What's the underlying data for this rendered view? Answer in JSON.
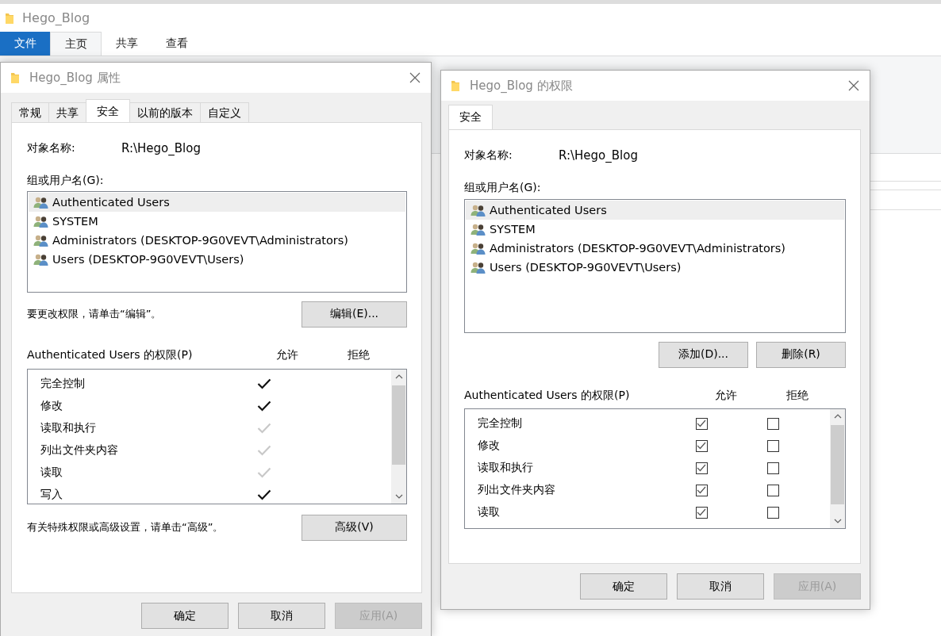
{
  "explorer": {
    "title": "Hego_Blog",
    "file_tab": "文件",
    "ribbon_tabs": [
      {
        "label": "主页",
        "selected": true
      },
      {
        "label": "共享",
        "selected": false
      },
      {
        "label": "查看",
        "selected": false
      }
    ]
  },
  "dialogs": [
    {
      "kind": "properties",
      "title": "Hego_Blog 属性",
      "tabs": [
        {
          "label": "常规",
          "selected": false
        },
        {
          "label": "共享",
          "selected": false
        },
        {
          "label": "安全",
          "selected": true
        },
        {
          "label": "以前的版本",
          "selected": false
        },
        {
          "label": "自定义",
          "selected": false
        }
      ],
      "object_label": "对象名称:",
      "object_value": "R:\\Hego_Blog",
      "groups_label": "组或用户名(G):",
      "users": [
        {
          "name": "Authenticated Users",
          "selected": true
        },
        {
          "name": "SYSTEM",
          "selected": false
        },
        {
          "name": "Administrators (DESKTOP-9G0VEVT\\Administrators)",
          "selected": false
        },
        {
          "name": "Users (DESKTOP-9G0VEVT\\Users)",
          "selected": false
        }
      ],
      "hint": "要更改权限，请单击“编辑”。",
      "user_buttons": [
        "编辑(E)..."
      ],
      "perm_title": "Authenticated Users 的权限(P)",
      "allow_label": "允许",
      "deny_label": "拒绝",
      "permissions": [
        {
          "name": "完全控制",
          "allow": {
            "checked": true,
            "inherited": false
          },
          "deny": {
            "checked": false
          }
        },
        {
          "name": "修改",
          "allow": {
            "checked": true,
            "inherited": false
          },
          "deny": {
            "checked": false
          }
        },
        {
          "name": "读取和执行",
          "allow": {
            "checked": true,
            "inherited": true
          },
          "deny": {
            "checked": false
          }
        },
        {
          "name": "列出文件夹内容",
          "allow": {
            "checked": true,
            "inherited": true
          },
          "deny": {
            "checked": false
          }
        },
        {
          "name": "读取",
          "allow": {
            "checked": true,
            "inherited": true
          },
          "deny": {
            "checked": false
          }
        },
        {
          "name": "写入",
          "allow": {
            "checked": true,
            "inherited": false
          },
          "deny": {
            "checked": false
          }
        }
      ],
      "advanced_hint": "有关特殊权限或高级设置，请单击“高级”。",
      "advanced_button": "高级(V)",
      "buttons": [
        {
          "label": "确定",
          "disabled": false
        },
        {
          "label": "取消",
          "disabled": false
        },
        {
          "label": "应用(A)",
          "disabled": true
        }
      ]
    },
    {
      "kind": "permissions",
      "title": "Hego_Blog 的权限",
      "tabs": [
        {
          "label": "安全",
          "selected": true
        }
      ],
      "object_label": "对象名称:",
      "object_value": "R:\\Hego_Blog",
      "groups_label": "组或用户名(G):",
      "users": [
        {
          "name": "Authenticated Users",
          "selected": true
        },
        {
          "name": "SYSTEM",
          "selected": false
        },
        {
          "name": "Administrators (DESKTOP-9G0VEVT\\Administrators)",
          "selected": false
        },
        {
          "name": "Users (DESKTOP-9G0VEVT\\Users)",
          "selected": false
        }
      ],
      "user_buttons": [
        "添加(D)...",
        "删除(R)"
      ],
      "perm_title": "Authenticated Users 的权限(P)",
      "allow_label": "允许",
      "deny_label": "拒绝",
      "permissions": [
        {
          "name": "完全控制",
          "allow": {
            "checked": true
          },
          "deny": {
            "checked": false
          }
        },
        {
          "name": "修改",
          "allow": {
            "checked": true
          },
          "deny": {
            "checked": false
          }
        },
        {
          "name": "读取和执行",
          "allow": {
            "checked": true
          },
          "deny": {
            "checked": false
          }
        },
        {
          "name": "列出文件夹内容",
          "allow": {
            "checked": true
          },
          "deny": {
            "checked": false
          }
        },
        {
          "name": "读取",
          "allow": {
            "checked": true
          },
          "deny": {
            "checked": false
          }
        }
      ],
      "buttons": [
        {
          "label": "确定",
          "disabled": false
        },
        {
          "label": "取消",
          "disabled": false
        },
        {
          "label": "应用(A)",
          "disabled": true
        }
      ]
    }
  ]
}
